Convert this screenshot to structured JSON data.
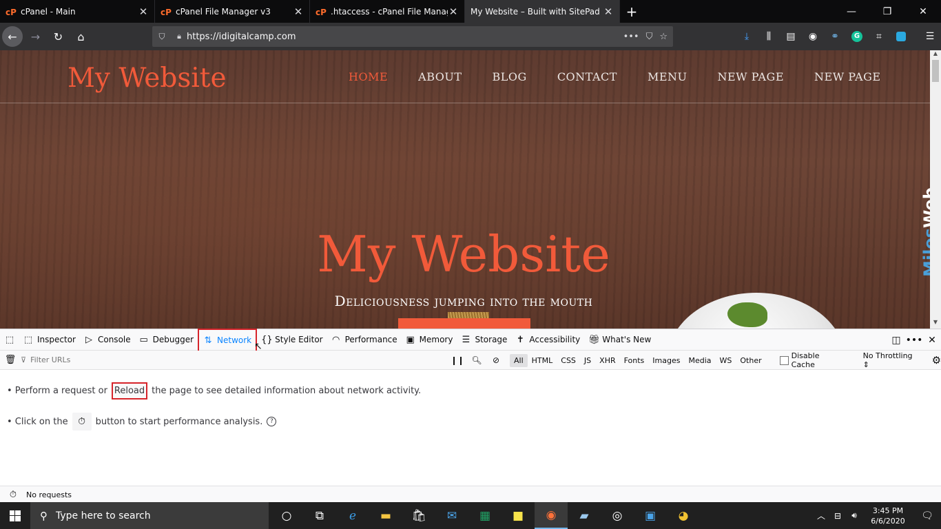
{
  "browser": {
    "tabs": [
      {
        "title": "cPanel - Main",
        "favicon": "cpanel-icon",
        "active": false
      },
      {
        "title": "cPanel File Manager v3",
        "favicon": "cpanel-icon",
        "active": false
      },
      {
        "title": ".htaccess - cPanel File Manager",
        "favicon": "cpanel-icon",
        "active": false
      },
      {
        "title": "My Website – Built with SitePad",
        "favicon": "",
        "active": true
      }
    ],
    "url": "https://idigitalcamp.com",
    "colors": {
      "tabstrip": "#0c0c0d",
      "toolbar": "#323234",
      "urlbar": "#474749"
    }
  },
  "website": {
    "logo": "My Website",
    "nav": [
      "HOME",
      "ABOUT",
      "BLOG",
      "CONTACT",
      "MENU",
      "NEW PAGE",
      "NEW PAGE"
    ],
    "active_nav": "HOME",
    "hero_title": "My Website",
    "hero_subtitle": "Deliciousness jumping into the mouth",
    "accent": "#f15a3a"
  },
  "watermark": {
    "part1": "Miles",
    "part2": "Web"
  },
  "devtools": {
    "tabs": [
      "Inspector",
      "Console",
      "Debugger",
      "Network",
      "Style Editor",
      "Performance",
      "Memory",
      "Storage",
      "Accessibility",
      "What's New"
    ],
    "active_tab": "Network",
    "filter_placeholder": "Filter URLs",
    "filter_types": [
      "All",
      "HTML",
      "CSS",
      "JS",
      "XHR",
      "Fonts",
      "Images",
      "Media",
      "WS",
      "Other"
    ],
    "selected_filter": "All",
    "disable_cache": "Disable Cache",
    "throttling": "No Throttling",
    "message1_prefix": "• Perform a request or",
    "reload_label": "Reload",
    "message1_suffix": "the page to see detailed information about network activity.",
    "message2_prefix": "• Click on the",
    "message2_suffix": "button to start performance analysis.",
    "status": "No requests"
  },
  "taskbar": {
    "search_placeholder": "Type here to search",
    "time": "3:45 PM",
    "date": "6/6/2020"
  }
}
